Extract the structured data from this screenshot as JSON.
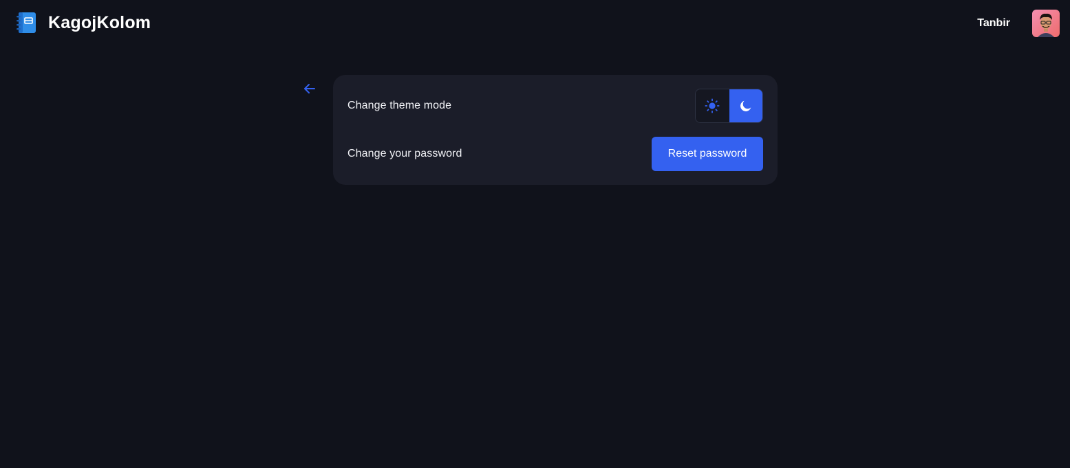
{
  "brand": {
    "name": "KagojKolom",
    "logo_icon": "notebook-icon"
  },
  "user": {
    "name": "Tanbir",
    "avatar_icon": "user-avatar"
  },
  "navigation": {
    "back_icon": "arrow-left-icon"
  },
  "settings": {
    "theme": {
      "label": "Change theme mode",
      "options": [
        {
          "name": "light",
          "icon": "sun-icon",
          "selected": false
        },
        {
          "name": "dark",
          "icon": "moon-icon",
          "selected": true
        }
      ]
    },
    "password": {
      "label": "Change your password",
      "button_label": "Reset password"
    }
  },
  "colors": {
    "background": "#10121b",
    "card": "#1b1d29",
    "accent": "#3461f0",
    "text": "#ffffff"
  }
}
